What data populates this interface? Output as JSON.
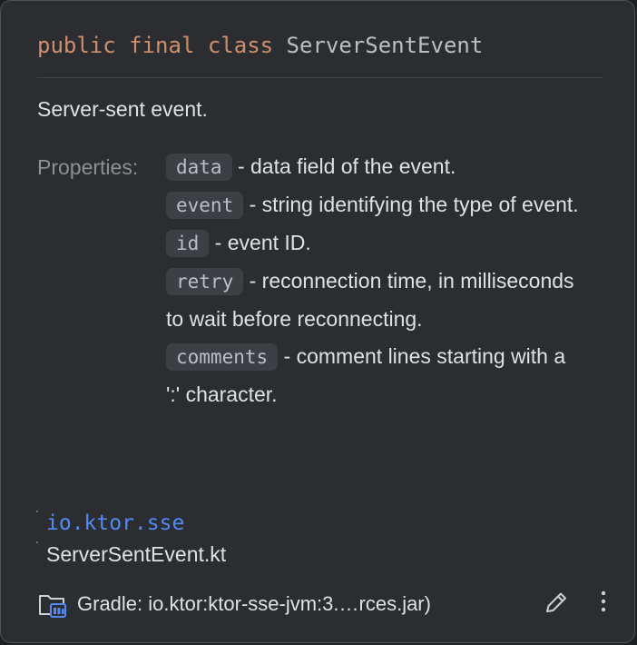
{
  "signature": {
    "modifiers": "public final class",
    "class_name": "ServerSentEvent"
  },
  "description": "Server-sent event.",
  "properties_label": "Properties:",
  "properties": [
    {
      "name": "data",
      "desc": " - data field of the event."
    },
    {
      "name": "event",
      "desc": " - string identifying the type of event."
    },
    {
      "name": "id",
      "desc": " - event ID."
    },
    {
      "name": "retry",
      "desc": " - reconnection time, in milliseconds to wait before reconnecting."
    },
    {
      "name": "comments",
      "desc": " - comment lines starting with a ':' character."
    }
  ],
  "location": {
    "package": "io.ktor.sse",
    "file": "ServerSentEvent.kt"
  },
  "footer": {
    "library": "Gradle: io.ktor:ktor-sse-jvm:3.…rces.jar)",
    "library_icon": "folder-library-icon",
    "edit_icon": "pencil-icon",
    "more_icon": "vertical-ellipsis-icon"
  },
  "colors": {
    "keyword": "#cf8e6d",
    "link": "#548af7",
    "background": "#2b2d30"
  }
}
